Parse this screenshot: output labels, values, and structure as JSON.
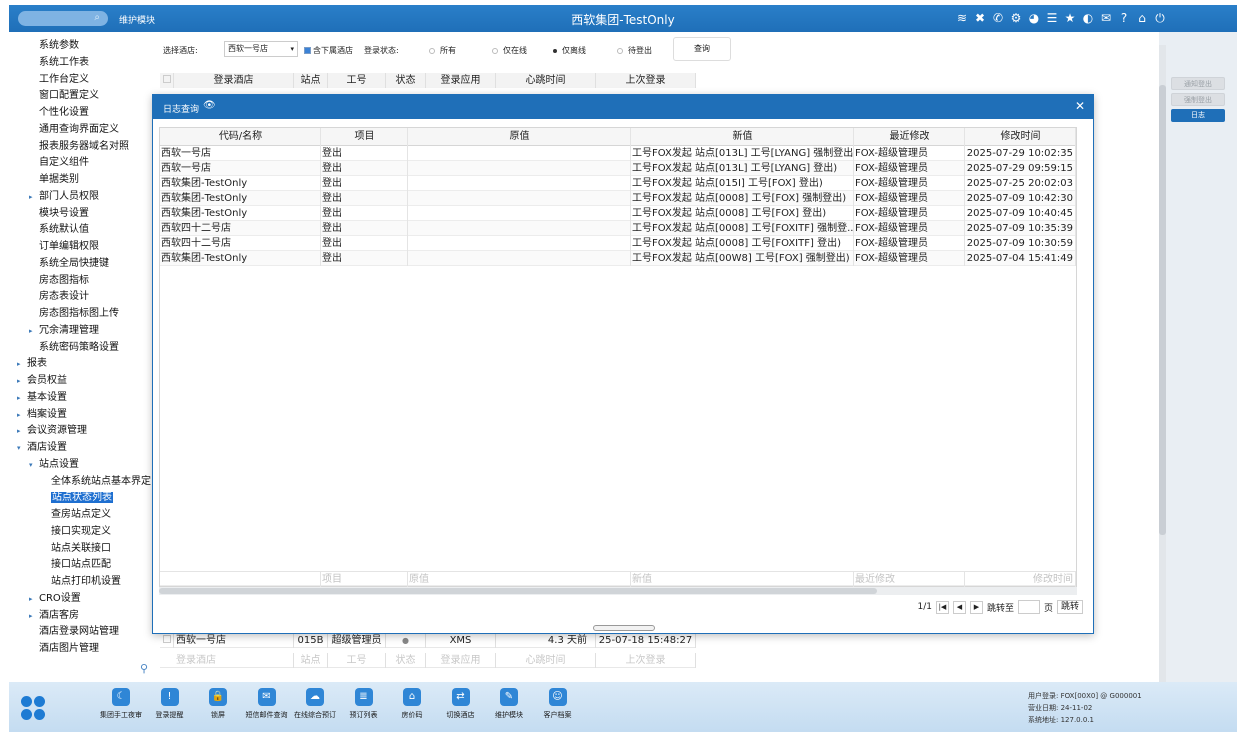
{
  "app": {
    "title": "西软集团-TestOnly",
    "module_label": "维护模块"
  },
  "topbar_icons": [
    "wifi-icon",
    "tools-icon",
    "phone-icon",
    "settings-gear-icon",
    "palette-icon",
    "menu-icon",
    "star-icon",
    "theme-icon",
    "mail-icon",
    "help-icon",
    "home-icon",
    "power-icon"
  ],
  "sidebar": {
    "items": [
      {
        "label": "系统参数",
        "indent": 2,
        "arrow": ""
      },
      {
        "label": "系统工作表",
        "indent": 2,
        "arrow": ""
      },
      {
        "label": "工作台定义",
        "indent": 2,
        "arrow": ""
      },
      {
        "label": "窗口配置定义",
        "indent": 2,
        "arrow": ""
      },
      {
        "label": "个性化设置",
        "indent": 2,
        "arrow": ""
      },
      {
        "label": "通用查询界面定义",
        "indent": 2,
        "arrow": ""
      },
      {
        "label": "报表服务器域名对照",
        "indent": 2,
        "arrow": ""
      },
      {
        "label": "自定义组件",
        "indent": 2,
        "arrow": ""
      },
      {
        "label": "单据类别",
        "indent": 2,
        "arrow": ""
      },
      {
        "label": "部门人员权限",
        "indent": 2,
        "arrow": "▸"
      },
      {
        "label": "模块号设置",
        "indent": 2,
        "arrow": ""
      },
      {
        "label": "系统默认值",
        "indent": 2,
        "arrow": ""
      },
      {
        "label": "订单编辑权限",
        "indent": 2,
        "arrow": ""
      },
      {
        "label": "系统全局快捷键",
        "indent": 2,
        "arrow": ""
      },
      {
        "label": "房态图指标",
        "indent": 2,
        "arrow": ""
      },
      {
        "label": "房态表设计",
        "indent": 2,
        "arrow": ""
      },
      {
        "label": "房态图指标图上传",
        "indent": 2,
        "arrow": ""
      },
      {
        "label": "冗余清理管理",
        "indent": 2,
        "arrow": "▸"
      },
      {
        "label": "系统密码策略设置",
        "indent": 2,
        "arrow": ""
      },
      {
        "label": "报表",
        "indent": 1,
        "arrow": "▸"
      },
      {
        "label": "会员权益",
        "indent": 1,
        "arrow": "▸"
      },
      {
        "label": "基本设置",
        "indent": 1,
        "arrow": "▸"
      },
      {
        "label": "档案设置",
        "indent": 1,
        "arrow": "▸"
      },
      {
        "label": "会议资源管理",
        "indent": 1,
        "arrow": "▸"
      },
      {
        "label": "酒店设置",
        "indent": 1,
        "arrow": "▾"
      },
      {
        "label": "站点设置",
        "indent": 2,
        "arrow": "▾"
      },
      {
        "label": "全体系统站点基本界定",
        "indent": 3,
        "arrow": ""
      },
      {
        "label": "站点状态列表",
        "indent": 3,
        "arrow": "",
        "selected": true
      },
      {
        "label": "查房站点定义",
        "indent": 3,
        "arrow": ""
      },
      {
        "label": "接口实现定义",
        "indent": 3,
        "arrow": ""
      },
      {
        "label": "站点关联接口",
        "indent": 3,
        "arrow": ""
      },
      {
        "label": "接口站点匹配",
        "indent": 3,
        "arrow": ""
      },
      {
        "label": "站点打印机设置",
        "indent": 3,
        "arrow": ""
      },
      {
        "label": "CRO设置",
        "indent": 2,
        "arrow": "▸"
      },
      {
        "label": "酒店客房",
        "indent": 2,
        "arrow": "▸"
      },
      {
        "label": "酒店登录网站管理",
        "indent": 2,
        "arrow": ""
      },
      {
        "label": "酒店图片管理",
        "indent": 2,
        "arrow": ""
      }
    ]
  },
  "filter": {
    "hotel_label": "选择酒店:",
    "hotel_value": "西软一号店",
    "include_sub_label": "含下属酒店",
    "login_status_label": "登录状态:",
    "radios": [
      {
        "label": "所有",
        "checked": false
      },
      {
        "label": "仅在线",
        "checked": false
      },
      {
        "label": "仅离线",
        "checked": true
      },
      {
        "label": "待登出",
        "checked": false
      }
    ],
    "query_button": "查询"
  },
  "bg_table": {
    "headers": [
      "登录酒店",
      "站点",
      "工号",
      "状态",
      "登录应用",
      "心跳时间",
      "上次登录"
    ],
    "rows": [
      [
        "西软一号店",
        "015B",
        "超级管理员",
        "●",
        "XMS",
        "4.3 天前",
        "25-07-18 15:48:27"
      ]
    ],
    "footer": [
      "登录酒店",
      "站点",
      "工号",
      "状态",
      "登录应用",
      "心跳时间",
      "上次登录"
    ]
  },
  "side_buttons": [
    {
      "label": "通知登出",
      "state": "disabled"
    },
    {
      "label": "强制登出",
      "state": "disabled"
    },
    {
      "label": "日志",
      "state": "active"
    }
  ],
  "dialog": {
    "title": "日志查询",
    "headers": [
      "代码/名称",
      "项目",
      "原值",
      "新值",
      "最近修改",
      "修改时间"
    ],
    "rows": [
      [
        "西软一号店",
        "登出",
        "",
        "工号FOX发起 站点[013L] 工号[LYANG] 强制登出)",
        "FOX-超级管理员",
        "2025-07-29 10:02:35"
      ],
      [
        "西软一号店",
        "登出",
        "",
        "工号FOX发起 站点[013L] 工号[LYANG] 登出)",
        "FOX-超级管理员",
        "2025-07-29 09:59:15"
      ],
      [
        "西软集团-TestOnly",
        "登出",
        "",
        "工号FOX发起 站点[015I] 工号[FOX] 登出)",
        "FOX-超级管理员",
        "2025-07-25 20:02:03"
      ],
      [
        "西软集团-TestOnly",
        "登出",
        "",
        "工号FOX发起 站点[0008] 工号[FOX] 强制登出)",
        "FOX-超级管理员",
        "2025-07-09 10:42:30"
      ],
      [
        "西软集团-TestOnly",
        "登出",
        "",
        "工号FOX发起 站点[0008] 工号[FOX] 登出)",
        "FOX-超级管理员",
        "2025-07-09 10:40:45"
      ],
      [
        "西软四十二号店",
        "登出",
        "",
        "工号FOX发起 站点[0008] 工号[FOXITF] 强制登...",
        "FOX-超级管理员",
        "2025-07-09 10:35:39"
      ],
      [
        "西软四十二号店",
        "登出",
        "",
        "工号FOX发起 站点[0008] 工号[FOXITF] 登出)",
        "FOX-超级管理员",
        "2025-07-09 10:30:59"
      ],
      [
        "西软集团-TestOnly",
        "登出",
        "",
        "工号FOX发起 站点[00W8] 工号[FOX] 强制登出)",
        "FOX-超级管理员",
        "2025-07-04 15:41:49"
      ]
    ],
    "footer": [
      "",
      "项目",
      "原值",
      "新值",
      "最近修改",
      "修改时间"
    ],
    "pager": {
      "page": "1/1",
      "jump_label": "跳转至",
      "page_unit": "页",
      "go_label": "跳转"
    }
  },
  "bottombar": {
    "items": [
      {
        "label": "集团手工夜审",
        "icon": "night-audit-icon",
        "glyph": "☾"
      },
      {
        "label": "登录提醒",
        "icon": "alert-icon",
        "glyph": "!"
      },
      {
        "label": "锁屏",
        "icon": "lock-icon",
        "glyph": "🔒"
      },
      {
        "label": "短信邮件查询",
        "icon": "mail-icon",
        "glyph": "✉"
      },
      {
        "label": "在线综合预订",
        "icon": "cloud-booking-icon",
        "glyph": "☁"
      },
      {
        "label": "预订列表",
        "icon": "list-icon",
        "glyph": "≣"
      },
      {
        "label": "房价码",
        "icon": "house-icon",
        "glyph": "⌂"
      },
      {
        "label": "切换酒店",
        "icon": "switch-icon",
        "glyph": "⇄"
      },
      {
        "label": "维护模块",
        "icon": "wrench-icon",
        "glyph": "✎"
      },
      {
        "label": "客户档案",
        "icon": "profile-icon",
        "glyph": "☺"
      }
    ],
    "status": {
      "user_line": "用户登录: FOX[00X0] @ G000001",
      "date_line": "营业日期: 24-11-02",
      "addr_line": "系统地址: 127.0.0.1"
    }
  }
}
